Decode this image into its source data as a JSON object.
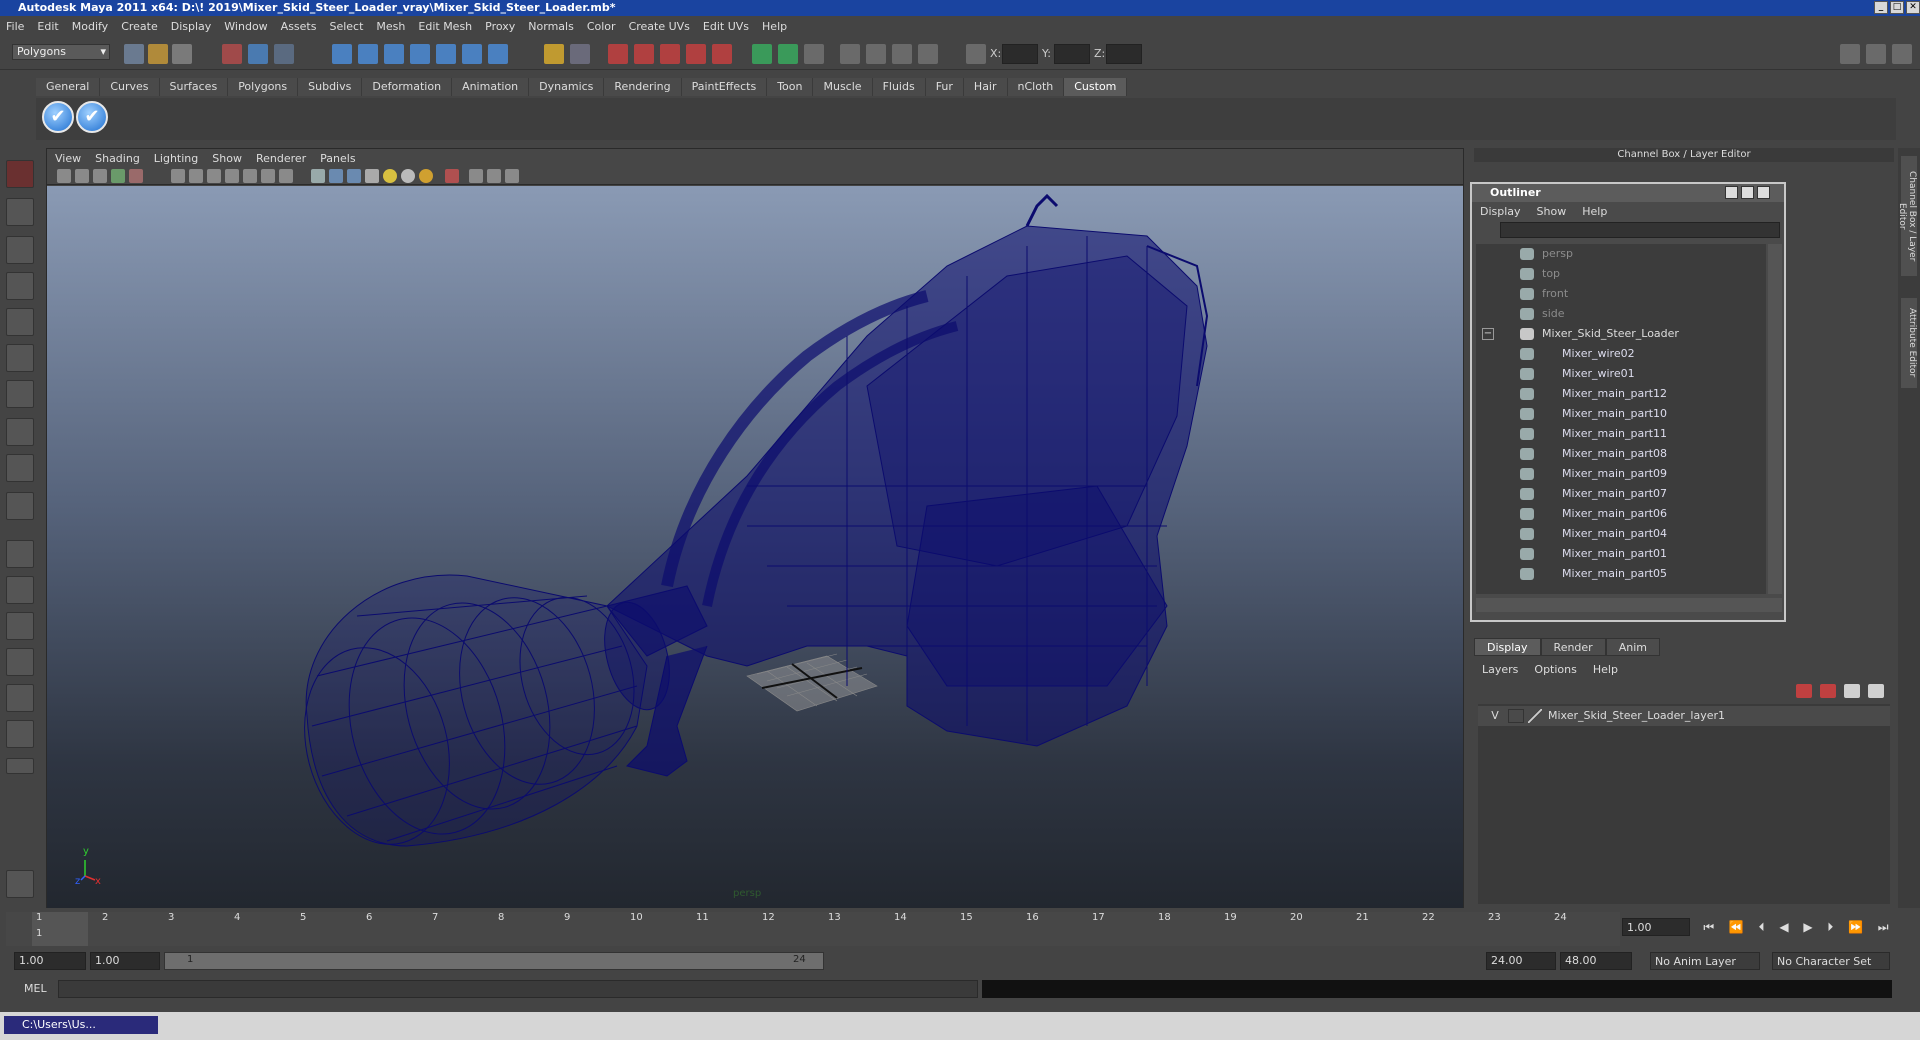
{
  "title": "Autodesk Maya 2011 x64: D:\\! 2019\\Mixer_Skid_Steer_Loader_vray\\Mixer_Skid_Steer_Loader.mb*",
  "menubar": [
    "File",
    "Edit",
    "Modify",
    "Create",
    "Display",
    "Window",
    "Assets",
    "Select",
    "Mesh",
    "Edit Mesh",
    "Proxy",
    "Normals",
    "Color",
    "Create UVs",
    "Edit UVs",
    "Help"
  ],
  "status_line": {
    "mode": "Polygons",
    "x_label": "X:",
    "y_label": "Y:",
    "z_label": "Z:"
  },
  "shelf_tabs": [
    "General",
    "Curves",
    "Surfaces",
    "Polygons",
    "Subdivs",
    "Deformation",
    "Animation",
    "Dynamics",
    "Rendering",
    "PaintEffects",
    "Toon",
    "Muscle",
    "Fluids",
    "Fur",
    "Hair",
    "nCloth",
    "Custom"
  ],
  "shelf_active": "Custom",
  "shelf_button_glyph": "✔",
  "viewport": {
    "menu": [
      "View",
      "Shading",
      "Lighting",
      "Show",
      "Renderer",
      "Panels"
    ],
    "camera_label": "persp",
    "axis_y": "y",
    "axis_x": "x",
    "axis_z": "z",
    "wire_color": "#0b0b6e",
    "grid_color": "#7a7a7a"
  },
  "channel_box_title": "Channel Box / Layer Editor",
  "side_tabs": [
    "Channel Box / Layer Editor",
    "Attribute Editor"
  ],
  "outliner": {
    "title": "Outliner",
    "menu": [
      "Display",
      "Show",
      "Help"
    ],
    "items": [
      {
        "label": "persp",
        "kind": "camera"
      },
      {
        "label": "top",
        "kind": "camera"
      },
      {
        "label": "front",
        "kind": "camera"
      },
      {
        "label": "side",
        "kind": "camera"
      },
      {
        "label": "Mixer_Skid_Steer_Loader",
        "kind": "group"
      },
      {
        "label": "Mixer_wire02",
        "kind": "child"
      },
      {
        "label": "Mixer_wire01",
        "kind": "child"
      },
      {
        "label": "Mixer_main_part12",
        "kind": "child"
      },
      {
        "label": "Mixer_main_part10",
        "kind": "child"
      },
      {
        "label": "Mixer_main_part11",
        "kind": "child"
      },
      {
        "label": "Mixer_main_part08",
        "kind": "child"
      },
      {
        "label": "Mixer_main_part09",
        "kind": "child"
      },
      {
        "label": "Mixer_main_part07",
        "kind": "child"
      },
      {
        "label": "Mixer_main_part06",
        "kind": "child"
      },
      {
        "label": "Mixer_main_part04",
        "kind": "child"
      },
      {
        "label": "Mixer_main_part01",
        "kind": "child"
      },
      {
        "label": "Mixer_main_part05",
        "kind": "child"
      }
    ],
    "collapse_glyph": "−"
  },
  "layer_editor": {
    "tabs": [
      "Display",
      "Render",
      "Anim"
    ],
    "active_tab": "Display",
    "menu": [
      "Layers",
      "Options",
      "Help"
    ],
    "layers": [
      {
        "visible": "V",
        "name": "Mixer_Skid_Steer_Loader_layer1"
      }
    ]
  },
  "timeline": {
    "ticks": [
      "1",
      "2",
      "3",
      "4",
      "5",
      "6",
      "7",
      "8",
      "9",
      "10",
      "11",
      "12",
      "13",
      "14",
      "15",
      "16",
      "17",
      "18",
      "19",
      "20",
      "21",
      "22",
      "23",
      "24"
    ],
    "current_marker": "1",
    "current_frame": "1.00",
    "play_controls": [
      "⏮",
      "⏪",
      "⏴",
      "◀",
      "▶",
      "⏵",
      "⏩",
      "⏭"
    ]
  },
  "range": {
    "start": "1.00",
    "playback_start": "1.00",
    "slider_start": "1",
    "slider_end": "24",
    "playback_end": "24.00",
    "end": "48.00",
    "anim_layer": "No Anim Layer",
    "character_set": "No Character Set"
  },
  "command_line": {
    "label": "MEL"
  },
  "taskbar": {
    "item": "C:\\Users\\Us..."
  }
}
